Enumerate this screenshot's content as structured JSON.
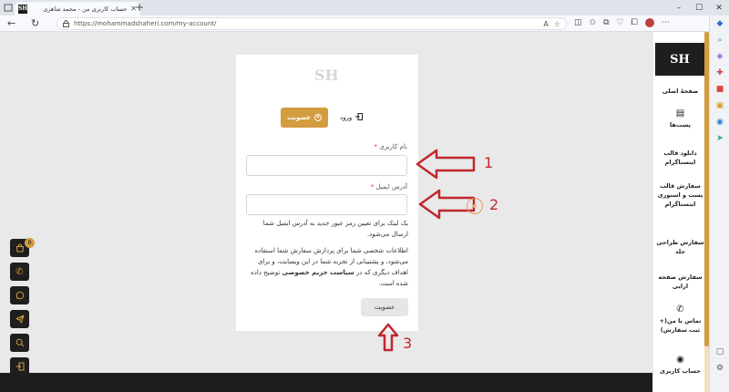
{
  "browser": {
    "tab_title": "حساب کاربری من - محمد شاهری",
    "favicon_text": "SH",
    "new_tab": "+",
    "url": "https://mohammadshaheri.com/my-account/"
  },
  "brand": {
    "logo_text": "SH",
    "accent": "#d39c3f",
    "dark": "#1e1e1e"
  },
  "auth": {
    "register_tab": "عضویت",
    "login_tab": "ورود",
    "username_label": "نام کاربری",
    "email_label": "آدرس ایمیل",
    "required_mark": "*",
    "password_note": "یک لینک برای تعیین رمز عبور جدید به آدرس ایمیل شما ارسال می‌شود.",
    "privacy_note_before": "اطلاعات شخصی شما برای پردازش سفارش شما استفاده می‌شود، و پشتیبانی از تجربه شما در این وبسایت، و برای اهداف دیگری که در ",
    "privacy_link": "سیاست حریم خصوصی",
    "privacy_note_after": " توضیح داده شده است.",
    "submit": "عضویت"
  },
  "annotations": {
    "one": "1",
    "two": "2",
    "three": "3",
    "color": "#c0272d"
  },
  "float_buttons": {
    "cart_badge": "0",
    "icons": [
      "cart-icon",
      "phone-icon",
      "whatsapp-icon",
      "telegram-icon",
      "search-icon",
      "login-icon"
    ]
  },
  "side_nav": {
    "home": "صفحهٔ اصلی",
    "posts": "پست‌ها",
    "download_template": "دانلود قالب اینستاگرام",
    "order_template": "سفارش قالب پست و استوری اینستاگرام",
    "order_cover": "سفارش طراحی جلد",
    "order_landing": "سفارش صفحه ارایی",
    "contact": "تماس با من(+ ثبت سفارش)",
    "account": "حساب کاربری"
  }
}
